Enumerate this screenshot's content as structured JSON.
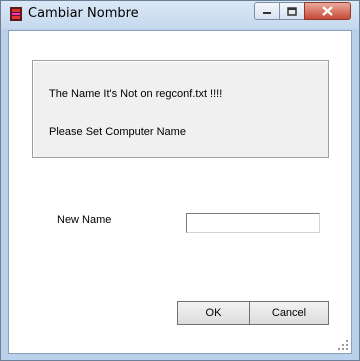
{
  "window": {
    "title": "Cambiar Nombre"
  },
  "icons": {
    "app": "app-icon",
    "minimize": "minimize-icon",
    "maximize": "maximize-icon",
    "close": "close-icon"
  },
  "message": {
    "line1": "The Name It's Not on regconf.txt !!!!",
    "line2": "Please Set Computer Name"
  },
  "form": {
    "new_name_label": "New Name",
    "new_name_value": ""
  },
  "buttons": {
    "ok_label": "OK",
    "cancel_label": "Cancel"
  },
  "colors": {
    "frame": "#b9d1ea",
    "close_button": "#c74a37",
    "client_background": "#ffffff",
    "group_background": "#f0f0f0"
  }
}
